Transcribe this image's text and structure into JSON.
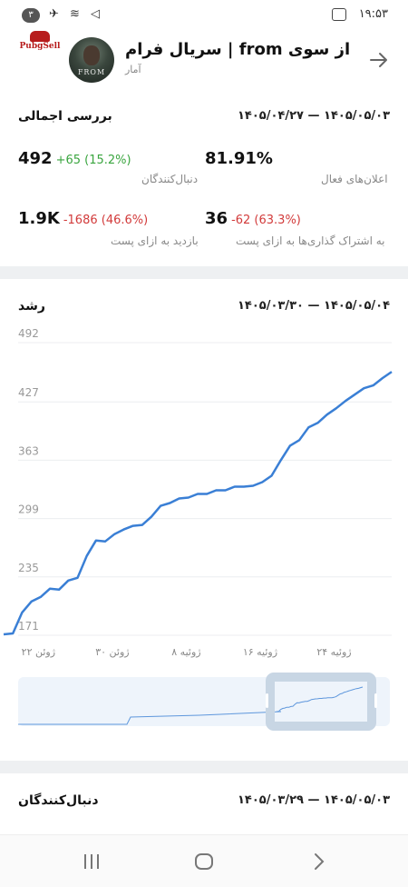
{
  "status_bar": {
    "time": "۱۹:۵۳",
    "notification_count": "۳"
  },
  "app_logo": {
    "text": "PubgSell"
  },
  "header": {
    "title": "سریال فرام | from از سوی",
    "subtitle": "آمار",
    "avatar_text": "FROM"
  },
  "overview": {
    "title": "بررسی اجمالی",
    "date_range": "۱۴۰۵/۰۴/۲۷ — ۱۴۰۵/۰۵/۰۳",
    "stats": [
      {
        "value": "492",
        "change": "+65 (15.2%)",
        "trend": "up",
        "label": "دنبال‌کنندگان"
      },
      {
        "value": "81.91%",
        "change": "",
        "trend": "",
        "label": "اعلان‌های فعال"
      },
      {
        "value": "1.9K",
        "change": "-1686 (46.6%)",
        "trend": "down",
        "label": "بازدید به ازای پست"
      },
      {
        "value": "36",
        "change": "-62 (63.3%)",
        "trend": "down",
        "label": "به اشتراک گذاری‌ها به ازای پست"
      }
    ]
  },
  "growth": {
    "title": "رشد",
    "date_range": "۱۴۰۵/۰۳/۳۰ — ۱۴۰۵/۰۵/۰۴"
  },
  "followers_section": {
    "title": "دنبال‌کنندگان",
    "date_range": "۱۴۰۵/۰۳/۲۹ — ۱۴۰۵/۰۵/۰۳"
  },
  "colors": {
    "line": "#3a7fd5",
    "up": "#3aa53f",
    "down": "#d23b3b",
    "divider": "#eef0f2"
  },
  "chart_data": {
    "type": "line",
    "title": "رشد",
    "y_ticks": [
      "171",
      "235",
      "299",
      "363",
      "427",
      "492"
    ],
    "x_ticks": [
      "ژوئن ۲۲",
      "ژوئن ۳۰",
      "ژوئیه ۸",
      "ژوئیه ۱۶",
      "ژوئیه ۲۴"
    ],
    "ylim": [
      171,
      492
    ],
    "xlim": [
      0,
      42
    ],
    "x_tick_positions": [
      2,
      10,
      18,
      26,
      34
    ],
    "grid": true,
    "series": [
      {
        "values": [
          [
            0,
            172
          ],
          [
            1,
            173
          ],
          [
            2,
            196
          ],
          [
            3,
            208
          ],
          [
            4,
            213
          ],
          [
            5,
            222
          ],
          [
            6,
            221
          ],
          [
            7,
            231
          ],
          [
            8,
            234
          ],
          [
            9,
            258
          ],
          [
            10,
            275
          ],
          [
            11,
            274
          ],
          [
            12,
            282
          ],
          [
            13,
            287
          ],
          [
            14,
            291
          ],
          [
            15,
            292
          ],
          [
            16,
            301
          ],
          [
            17,
            313
          ],
          [
            18,
            316
          ],
          [
            19,
            321
          ],
          [
            20,
            322
          ],
          [
            21,
            326
          ],
          [
            22,
            326
          ],
          [
            23,
            330
          ],
          [
            24,
            330
          ],
          [
            25,
            334
          ],
          [
            26,
            334
          ],
          [
            27,
            335
          ],
          [
            28,
            339
          ],
          [
            29,
            346
          ],
          [
            30,
            363
          ],
          [
            31,
            379
          ],
          [
            32,
            385
          ],
          [
            33,
            399
          ],
          [
            34,
            404
          ],
          [
            35,
            413
          ],
          [
            36,
            420
          ],
          [
            37,
            428
          ],
          [
            38,
            435
          ],
          [
            39,
            442
          ],
          [
            40,
            445
          ],
          [
            41,
            453
          ],
          [
            42,
            460
          ]
        ]
      }
    ]
  },
  "navigation": {
    "buttons": [
      "recent-apps",
      "home",
      "back"
    ]
  }
}
